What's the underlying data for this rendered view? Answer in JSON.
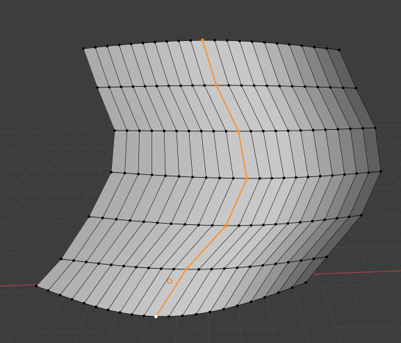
{
  "viewport": {
    "mode": "edit",
    "background": "#3d3d3d",
    "grid_color": "#474747",
    "x_axis_color": "#a0404a",
    "mesh": {
      "face_light": "#c8c8c8",
      "face_dark": "#5a5a5a",
      "edge_color": "#111111",
      "vertex_color": "#000000",
      "selected_edge_color": "#ff8a1f",
      "selected_vertex_color": "#ff8a1f",
      "active_vertex_color": "#ffffff",
      "rings": 7,
      "segments": 21
    },
    "origin_marker": {
      "color": "#ff8a1f"
    }
  }
}
